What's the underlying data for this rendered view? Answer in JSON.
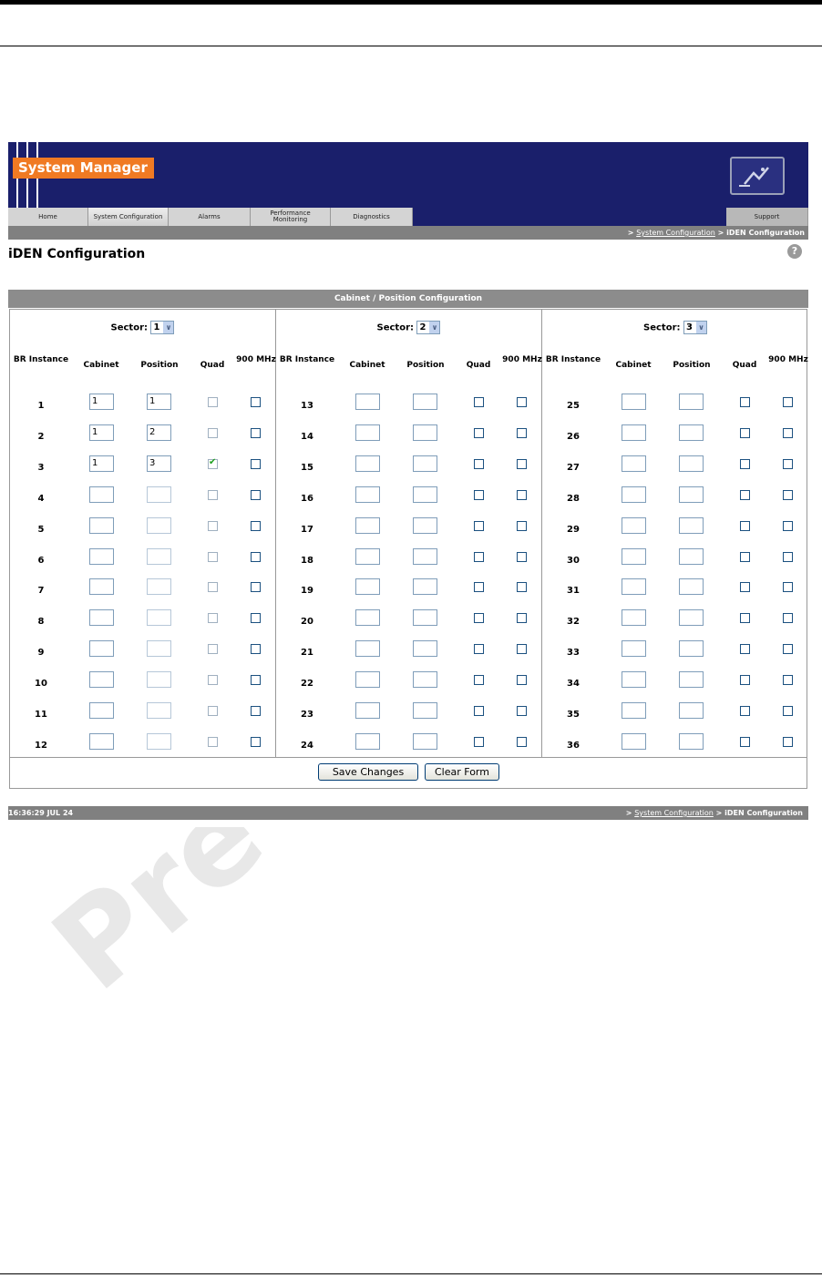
{
  "app": {
    "brand": "System Manager",
    "colors": {
      "banner": "#1a1f6b",
      "brand": "#f07a23",
      "bar": "#808080"
    }
  },
  "tabs": [
    {
      "label": "Home"
    },
    {
      "label": "System Configuration"
    },
    {
      "label": "Alarms"
    },
    {
      "label": "Performance Monitoring"
    },
    {
      "label": "Diagnostics"
    }
  ],
  "support_tab": "Support",
  "breadcrumb": {
    "sep1": ">",
    "link": "System Configuration",
    "sep2": ">",
    "current": "iDEN Configuration"
  },
  "page": {
    "title": "iDEN Configuration",
    "help_icon": "?"
  },
  "section": {
    "title": "Cabinet / Position Configuration"
  },
  "columns": {
    "br_instance": "BR Instance",
    "cabinet": "Cabinet",
    "position": "Position",
    "quad": "Quad",
    "mhz900": "900 MHz"
  },
  "sector_label": "Sector:",
  "sectors": [
    {
      "sector": "1",
      "rows": [
        {
          "inst": "1",
          "cabinet": "1",
          "position": "1",
          "quad": false,
          "mhz900": false
        },
        {
          "inst": "2",
          "cabinet": "1",
          "position": "2",
          "quad": false,
          "mhz900": false
        },
        {
          "inst": "3",
          "cabinet": "1",
          "position": "3",
          "quad": true,
          "mhz900": false
        },
        {
          "inst": "4",
          "cabinet": "",
          "position": "",
          "quad": false,
          "mhz900": false
        },
        {
          "inst": "5",
          "cabinet": "",
          "position": "",
          "quad": false,
          "mhz900": false
        },
        {
          "inst": "6",
          "cabinet": "",
          "position": "",
          "quad": false,
          "mhz900": false
        },
        {
          "inst": "7",
          "cabinet": "",
          "position": "",
          "quad": false,
          "mhz900": false
        },
        {
          "inst": "8",
          "cabinet": "",
          "position": "",
          "quad": false,
          "mhz900": false
        },
        {
          "inst": "9",
          "cabinet": "",
          "position": "",
          "quad": false,
          "mhz900": false
        },
        {
          "inst": "10",
          "cabinet": "",
          "position": "",
          "quad": false,
          "mhz900": false
        },
        {
          "inst": "11",
          "cabinet": "",
          "position": "",
          "quad": false,
          "mhz900": false
        },
        {
          "inst": "12",
          "cabinet": "",
          "position": "",
          "quad": false,
          "mhz900": false
        }
      ]
    },
    {
      "sector": "2",
      "rows": [
        {
          "inst": "13",
          "cabinet": "",
          "position": "",
          "quad": false,
          "mhz900": false
        },
        {
          "inst": "14",
          "cabinet": "",
          "position": "",
          "quad": false,
          "mhz900": false
        },
        {
          "inst": "15",
          "cabinet": "",
          "position": "",
          "quad": false,
          "mhz900": false
        },
        {
          "inst": "16",
          "cabinet": "",
          "position": "",
          "quad": false,
          "mhz900": false
        },
        {
          "inst": "17",
          "cabinet": "",
          "position": "",
          "quad": false,
          "mhz900": false
        },
        {
          "inst": "18",
          "cabinet": "",
          "position": "",
          "quad": false,
          "mhz900": false
        },
        {
          "inst": "19",
          "cabinet": "",
          "position": "",
          "quad": false,
          "mhz900": false
        },
        {
          "inst": "20",
          "cabinet": "",
          "position": "",
          "quad": false,
          "mhz900": false
        },
        {
          "inst": "21",
          "cabinet": "",
          "position": "",
          "quad": false,
          "mhz900": false
        },
        {
          "inst": "22",
          "cabinet": "",
          "position": "",
          "quad": false,
          "mhz900": false
        },
        {
          "inst": "23",
          "cabinet": "",
          "position": "",
          "quad": false,
          "mhz900": false
        },
        {
          "inst": "24",
          "cabinet": "",
          "position": "",
          "quad": false,
          "mhz900": false
        }
      ]
    },
    {
      "sector": "3",
      "rows": [
        {
          "inst": "25",
          "cabinet": "",
          "position": "",
          "quad": false,
          "mhz900": false
        },
        {
          "inst": "26",
          "cabinet": "",
          "position": "",
          "quad": false,
          "mhz900": false
        },
        {
          "inst": "27",
          "cabinet": "",
          "position": "",
          "quad": false,
          "mhz900": false
        },
        {
          "inst": "28",
          "cabinet": "",
          "position": "",
          "quad": false,
          "mhz900": false
        },
        {
          "inst": "29",
          "cabinet": "",
          "position": "",
          "quad": false,
          "mhz900": false
        },
        {
          "inst": "30",
          "cabinet": "",
          "position": "",
          "quad": false,
          "mhz900": false
        },
        {
          "inst": "31",
          "cabinet": "",
          "position": "",
          "quad": false,
          "mhz900": false
        },
        {
          "inst": "32",
          "cabinet": "",
          "position": "",
          "quad": false,
          "mhz900": false
        },
        {
          "inst": "33",
          "cabinet": "",
          "position": "",
          "quad": false,
          "mhz900": false
        },
        {
          "inst": "34",
          "cabinet": "",
          "position": "",
          "quad": false,
          "mhz900": false
        },
        {
          "inst": "35",
          "cabinet": "",
          "position": "",
          "quad": false,
          "mhz900": false
        },
        {
          "inst": "36",
          "cabinet": "",
          "position": "",
          "quad": false,
          "mhz900": false
        }
      ]
    }
  ],
  "buttons": {
    "save": "Save Changes",
    "clear": "Clear Form"
  },
  "footer": {
    "time": "16:36:29 JUL 24"
  },
  "watermark": "Pre"
}
